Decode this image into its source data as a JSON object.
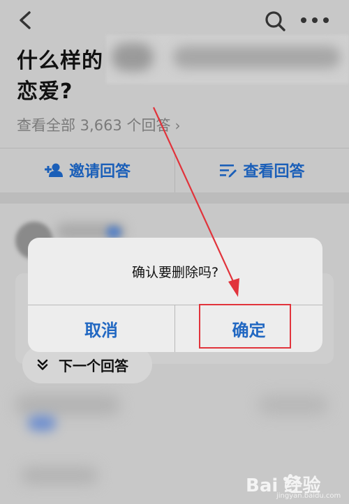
{
  "question": {
    "title_line1": "什么样的",
    "title_line2": "恋爱?",
    "view_all": "查看全部 3,663 个回答",
    "view_all_chevron": "›"
  },
  "actions": {
    "invite_label": "邀请回答",
    "view_label": "查看回答"
  },
  "next_answer": {
    "label": "下一个回答"
  },
  "modal": {
    "message": "确认要删除吗?",
    "cancel_label": "取消",
    "confirm_label": "确定"
  },
  "watermark": {
    "brand": "Bai 经验",
    "url": "jingyan.baidu.com"
  },
  "colors": {
    "accent": "#2268c2",
    "annotation": "#e1333b"
  },
  "icons": [
    "back-icon",
    "search-icon",
    "more-icon",
    "add-user-icon",
    "list-edit-icon",
    "double-chevron-down-icon",
    "paw-icon"
  ]
}
